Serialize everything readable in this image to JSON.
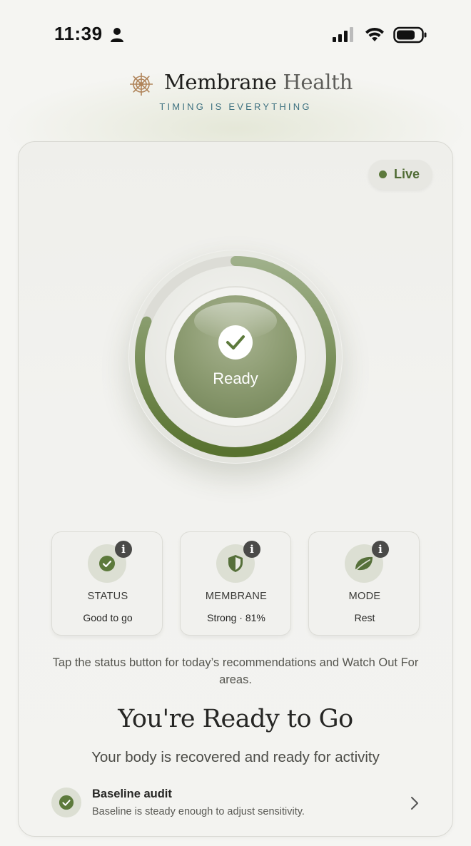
{
  "status_bar": {
    "time": "11:39",
    "person_icon": "person-icon",
    "signal_icon": "cellular-signal-icon",
    "wifi_icon": "wifi-icon",
    "battery_icon": "battery-icon"
  },
  "brand": {
    "logo_icon": "ship-wheel-icon",
    "name_primary": "Membrane",
    "name_secondary": "Health",
    "tagline": "TIMING IS EVERYTHING"
  },
  "live_badge": {
    "label": "Live"
  },
  "ring": {
    "status_label": "Ready",
    "check_icon": "check-icon",
    "progress_fraction": 0.81,
    "accent_color": "#5d7a3c"
  },
  "tiles": [
    {
      "title": "STATUS",
      "value": "Good to go",
      "icon": "check-circle-icon",
      "info_icon": "info-icon"
    },
    {
      "title": "MEMBRANE",
      "value": "Strong · 81%",
      "icon": "shield-icon",
      "info_icon": "info-icon"
    },
    {
      "title": "MODE",
      "value": "Rest",
      "icon": "leaf-icon",
      "info_icon": "info-icon"
    }
  ],
  "tip": "Tap the status button for today’s recommendations and Watch Out For areas.",
  "headline": "You're Ready to Go",
  "subline": "Your body is recovered and ready for activity",
  "audit": {
    "title": "Baseline audit",
    "description": "Baseline is steady enough to adjust sensitivity.",
    "icon": "check-circle-icon",
    "chevron_icon": "chevron-right-icon"
  },
  "colors": {
    "accent_green": "#5d7a3c",
    "tagline_teal": "#3f7281",
    "brand_gold": "#b0845a"
  }
}
